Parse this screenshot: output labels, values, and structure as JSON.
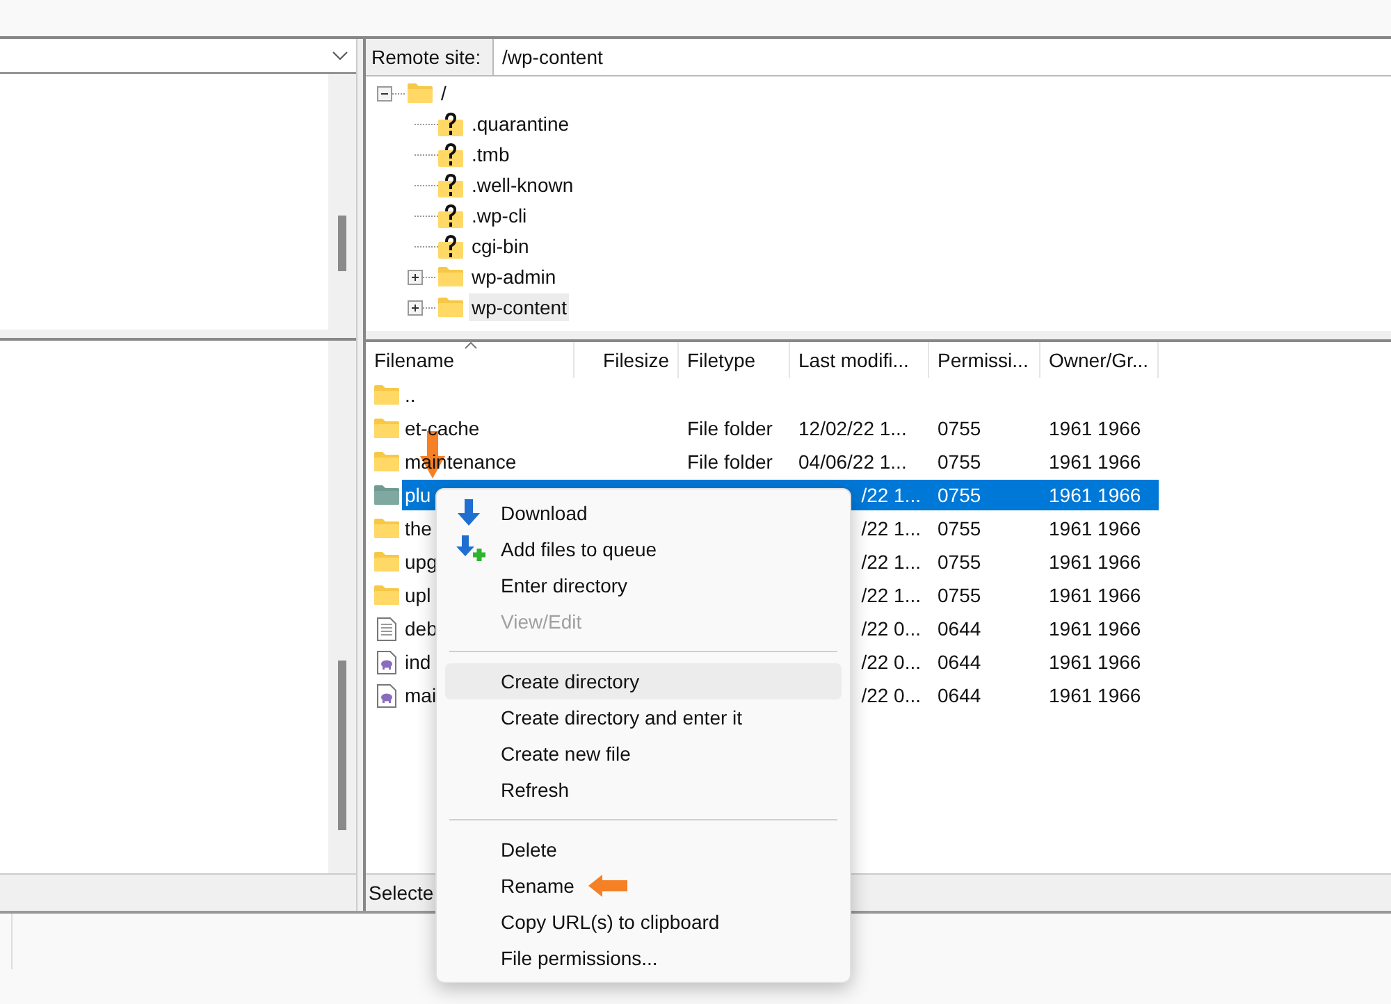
{
  "remote_site": {
    "label": "Remote site:",
    "path": "/wp-content"
  },
  "remote_tree": [
    {
      "name": "/",
      "kind": "folder",
      "expanded": true,
      "highlighted": false,
      "children": [
        {
          "name": ".quarantine",
          "kind": "unknown",
          "highlighted": false
        },
        {
          "name": ".tmb",
          "kind": "unknown",
          "highlighted": false
        },
        {
          "name": ".well-known",
          "kind": "unknown",
          "highlighted": false
        },
        {
          "name": ".wp-cli",
          "kind": "unknown",
          "highlighted": false
        },
        {
          "name": "cgi-bin",
          "kind": "unknown",
          "highlighted": false
        },
        {
          "name": "wp-admin",
          "kind": "folder",
          "expanded": false,
          "highlighted": false
        },
        {
          "name": "wp-content",
          "kind": "folder",
          "expanded": false,
          "highlighted": true
        }
      ]
    }
  ],
  "file_list": {
    "columns": [
      {
        "label": "Filename",
        "sorted": true
      },
      {
        "label": "Filesize",
        "sorted": false
      },
      {
        "label": "Filetype",
        "sorted": false
      },
      {
        "label": "Last modifi...",
        "sorted": false
      },
      {
        "label": "Permissi...",
        "sorted": false
      },
      {
        "label": "Owner/Gr...",
        "sorted": false
      }
    ],
    "rows": [
      {
        "kind": "folder",
        "name": "..",
        "type": "",
        "modified": "",
        "permissions": "",
        "owner": "",
        "selected": false
      },
      {
        "kind": "folder",
        "name": "et-cache",
        "type": "File folder",
        "modified": "12/02/22 1...",
        "permissions": "0755",
        "owner": "1961 1966",
        "selected": false
      },
      {
        "kind": "folder",
        "name": "maintenance",
        "type": "File folder",
        "modified": "04/06/22 1...",
        "permissions": "0755",
        "owner": "1961 1966",
        "selected": false
      },
      {
        "kind": "folder",
        "name": "plu",
        "type": "",
        "modified": "/22 1...",
        "permissions": "0755",
        "owner": "1961 1966",
        "selected": true
      },
      {
        "kind": "folder",
        "name": "the",
        "type": "",
        "modified": "/22 1...",
        "permissions": "0755",
        "owner": "1961 1966",
        "selected": false
      },
      {
        "kind": "folder",
        "name": "upg",
        "type": "",
        "modified": "/22 1...",
        "permissions": "0755",
        "owner": "1961 1966",
        "selected": false
      },
      {
        "kind": "folder",
        "name": "upl",
        "type": "",
        "modified": "/22 1...",
        "permissions": "0755",
        "owner": "1961 1966",
        "selected": false
      },
      {
        "kind": "text",
        "name": "deb",
        "type": "",
        "modified": "/22 0...",
        "permissions": "0644",
        "owner": "1961 1966",
        "selected": false
      },
      {
        "kind": "php",
        "name": "ind",
        "type": "",
        "modified": "/22 0...",
        "permissions": "0644",
        "owner": "1961 1966",
        "selected": false
      },
      {
        "kind": "php",
        "name": "mai",
        "type": "",
        "modified": "/22 0...",
        "permissions": "0644",
        "owner": "1961 1966",
        "selected": false
      }
    ]
  },
  "remote_status": "Selecte",
  "context_menu": {
    "groups": [
      [
        {
          "label": "Download",
          "kind": "download",
          "disabled": false,
          "highlighted": false
        },
        {
          "label": "Add files to queue",
          "kind": "queue",
          "disabled": false,
          "highlighted": false
        },
        {
          "label": "Enter directory",
          "disabled": false,
          "highlighted": false
        },
        {
          "label": "View/Edit",
          "disabled": true,
          "highlighted": false
        }
      ],
      [
        {
          "label": "Create directory",
          "disabled": false,
          "highlighted": true
        },
        {
          "label": "Create directory and enter it",
          "disabled": false,
          "highlighted": false
        },
        {
          "label": "Create new file",
          "disabled": false,
          "highlighted": false
        },
        {
          "label": "Refresh",
          "disabled": false,
          "highlighted": false
        }
      ],
      [
        {
          "label": "Delete",
          "disabled": false,
          "highlighted": false
        },
        {
          "label": "Rename",
          "disabled": false,
          "highlighted": false,
          "pointer": true
        },
        {
          "label": "Copy URL(s) to clipboard",
          "disabled": false,
          "highlighted": false
        },
        {
          "label": "File permissions...",
          "disabled": false,
          "highlighted": false
        }
      ]
    ]
  }
}
